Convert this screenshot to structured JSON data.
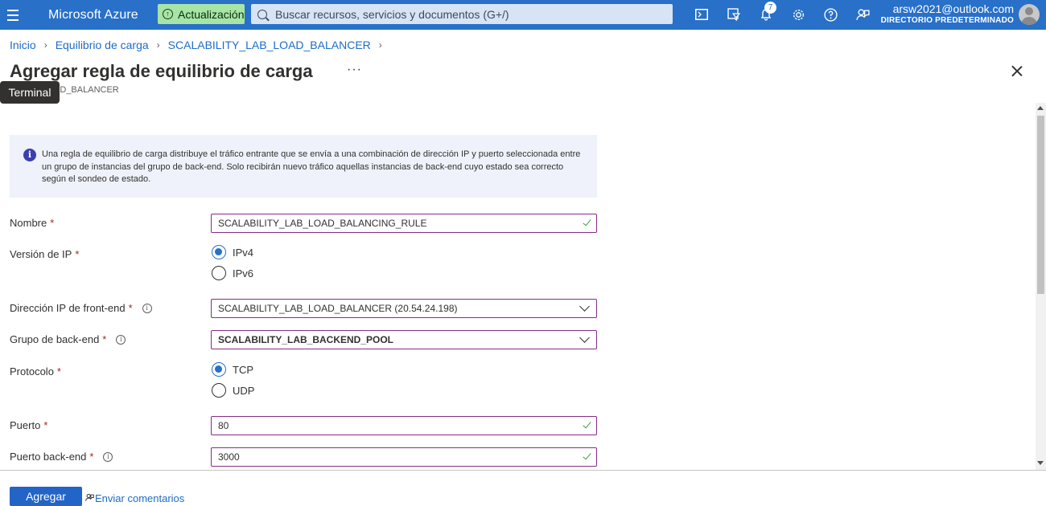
{
  "topbar": {
    "brand": "Microsoft Azure",
    "update_label": "Actualización",
    "search_placeholder": "Buscar recursos, servicios y documentos (G+/)",
    "notification_count": "7",
    "account_email": "arsw2021@outlook.com",
    "account_directory": "DIRECTORIO PREDETERMINADO"
  },
  "breadcrumb": {
    "items": [
      "Inicio",
      "Equilibrio de carga",
      "SCALABILITY_LAB_LOAD_BALANCER"
    ]
  },
  "header": {
    "title": "Agregar regla de equilibrio de carga",
    "more": "···",
    "subtitle": "Y_LAB_LOAD_BALANCER",
    "tooltip": "Terminal"
  },
  "info": {
    "text": "Una regla de equilibrio de carga distribuye el tráfico entrante que se envía a una combinación de dirección IP y puerto seleccionada entre un grupo de instancias del grupo de back-end. Solo recibirán nuevo tráfico aquellas instancias de back-end cuyo estado sea correcto según el sondeo de estado."
  },
  "form": {
    "name_label": "Nombre",
    "name_value": "SCALABILITY_LAB_LOAD_BALANCING_RULE",
    "ip_version_label": "Versión de IP",
    "ip_options": [
      "IPv4",
      "IPv6"
    ],
    "ip_selected": "IPv4",
    "frontend_label": "Dirección IP de front-end",
    "frontend_value": "SCALABILITY_LAB_LOAD_BALANCER (20.54.24.198)",
    "backend_pool_label": "Grupo de back-end",
    "backend_pool_value": "SCALABILITY_LAB_BACKEND_POOL",
    "protocol_label": "Protocolo",
    "protocol_options": [
      "TCP",
      "UDP"
    ],
    "protocol_selected": "TCP",
    "port_label": "Puerto",
    "port_value": "80",
    "backend_port_label": "Puerto back-end",
    "backend_port_value": "3000",
    "required_mark": "*",
    "help_glyph": "i"
  },
  "footer": {
    "add_label": "Agregar",
    "feedback_label": "Enviar comentarios"
  }
}
